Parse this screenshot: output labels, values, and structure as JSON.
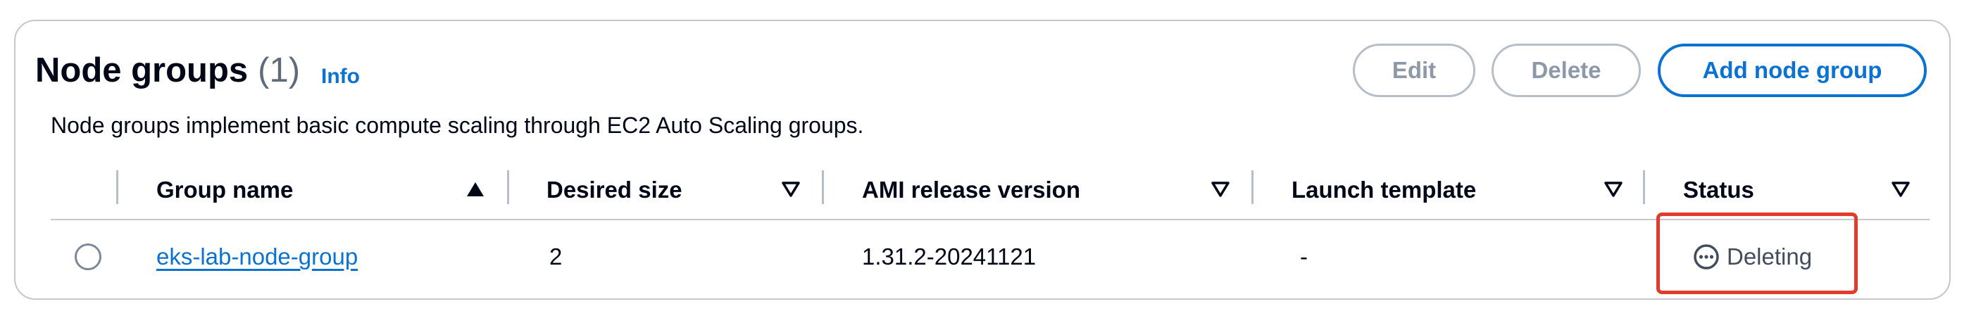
{
  "section": {
    "title": "Node groups",
    "count": "(1)",
    "info_label": "Info",
    "description": "Node groups implement basic compute scaling through EC2 Auto Scaling groups."
  },
  "actions": {
    "edit_label": "Edit",
    "delete_label": "Delete",
    "add_label": "Add node group"
  },
  "table": {
    "columns": [
      {
        "label": "Group name",
        "sort": "ascending"
      },
      {
        "label": "Desired size",
        "sort": "none"
      },
      {
        "label": "AMI release version",
        "sort": "none"
      },
      {
        "label": "Launch template",
        "sort": "none"
      },
      {
        "label": "Status",
        "sort": "none"
      }
    ],
    "rows": [
      {
        "group_name": "eks-lab-node-group",
        "desired_size": "2",
        "ami_release_version": "1.31.2-20241121",
        "launch_template": "-",
        "status": "Deleting",
        "status_icon": "ellipsis-circle-icon",
        "selected": false
      }
    ]
  },
  "colors": {
    "link": "#0972d3",
    "primary_border": "#0972d3",
    "disabled": "#8d99a8",
    "highlight": "#e13b2c"
  }
}
